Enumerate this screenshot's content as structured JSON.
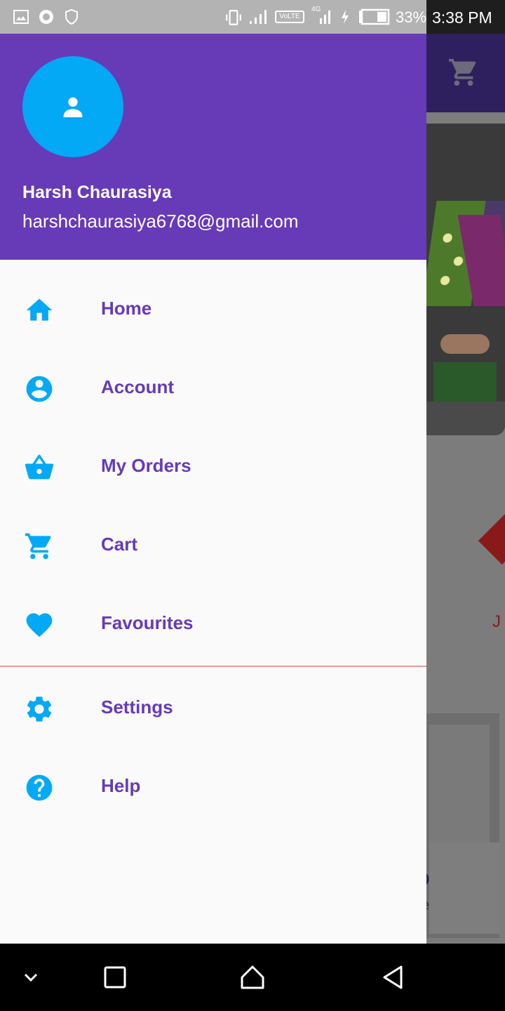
{
  "status_bar": {
    "battery_percent": "33%",
    "time": "3:38 PM",
    "network_label": "VoLTE",
    "network_type": "4G"
  },
  "drawer": {
    "header": {
      "name": "Harsh Chaurasiya",
      "email": "harshchaurasiya6768@gmail.com",
      "avatar_icon": "person-icon"
    },
    "items": [
      {
        "label": "Home",
        "icon": "home-icon"
      },
      {
        "label": "Account",
        "icon": "account-circle-icon"
      },
      {
        "label": "My Orders",
        "icon": "shopping-basket-icon"
      },
      {
        "label": "Cart",
        "icon": "cart-icon"
      },
      {
        "label": "Favourites",
        "icon": "heart-icon"
      }
    ],
    "secondary_items": [
      {
        "label": "Settings",
        "icon": "gear-icon"
      },
      {
        "label": "Help",
        "icon": "help-icon"
      }
    ]
  },
  "background": {
    "brand_text": "J",
    "price_fragment": "0",
    "price_fragment_2": "e"
  },
  "colors": {
    "header": "#673ab7",
    "accent_icon": "#03a9f4",
    "label": "#673ab7",
    "divider": "#ef9a9a"
  }
}
